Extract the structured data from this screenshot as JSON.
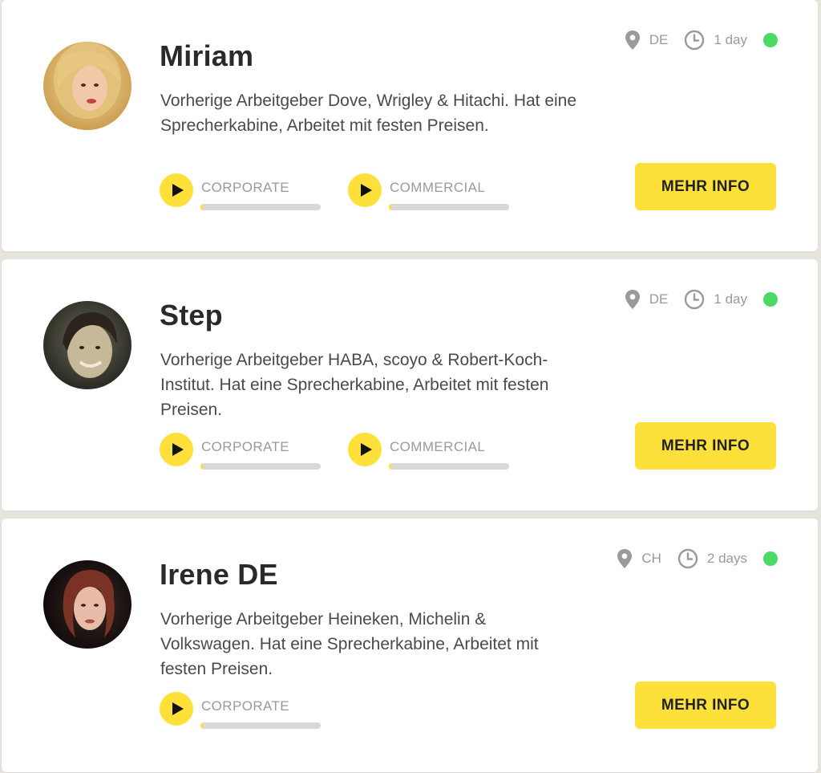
{
  "colors": {
    "accent": "#fde03a",
    "online": "#4cd964",
    "meta_text": "#9a9a9a",
    "background": "#e6e4dc"
  },
  "cards": [
    {
      "name": "Miriam",
      "description": "Vorherige Arbeitgeber Dove, Wrigley & Hitachi. Hat eine Sprecherkabine, Arbeitet mit festen Preisen.",
      "country": "DE",
      "response_time": "1 day",
      "online": true,
      "samples": [
        {
          "label": "CORPORATE",
          "progress": 0.01
        },
        {
          "label": "COMMERCIAL",
          "progress": 0.01
        }
      ],
      "button_label": "MEHR INFO"
    },
    {
      "name": "Step",
      "description": "Vorherige Arbeitgeber HABA, scoyo & Robert-Koch-Institut. Hat eine Sprecherkabine, Arbeitet mit festen Preisen.",
      "country": "DE",
      "response_time": "1 day",
      "online": true,
      "samples": [
        {
          "label": "CORPORATE",
          "progress": 0.01
        },
        {
          "label": "COMMERCIAL",
          "progress": 0.01
        }
      ],
      "button_label": "MEHR INFO"
    },
    {
      "name": "Irene DE",
      "description": "Vorherige Arbeitgeber Heineken, Michelin & Volkswagen. Hat eine Sprecherkabine, Arbeitet mit festen Preisen.",
      "country": "CH",
      "response_time": "2 days",
      "online": true,
      "samples": [
        {
          "label": "CORPORATE",
          "progress": 0.01
        }
      ],
      "button_label": "MEHR INFO"
    }
  ],
  "icons": {
    "location": "location-pin-icon",
    "time": "clock-icon",
    "play": "play-icon",
    "status": "online-status-dot"
  }
}
